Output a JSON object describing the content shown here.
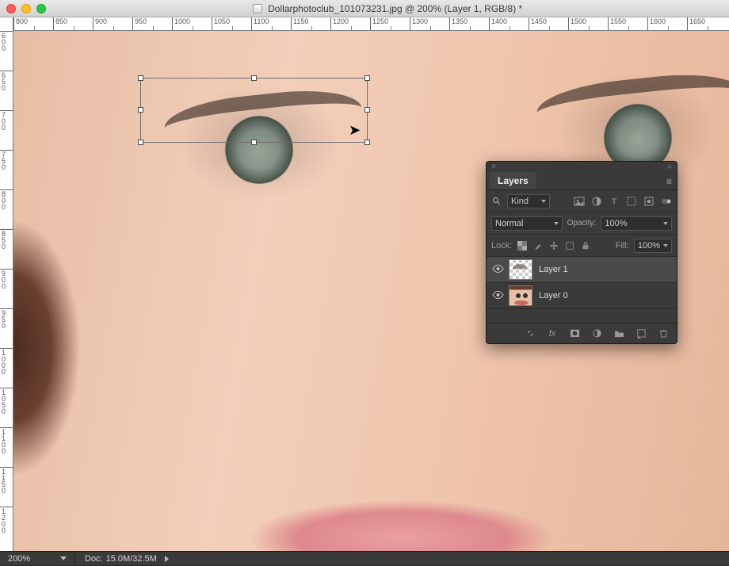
{
  "window": {
    "title": "Dollarphotoclub_101073231.jpg @ 200% (Layer 1, RGB/8) *"
  },
  "rulers": {
    "horizontal": [
      "800",
      "850",
      "900",
      "950",
      "1000",
      "1050",
      "1100",
      "1150",
      "1200",
      "1250",
      "1300",
      "1350",
      "1400",
      "1450",
      "1500",
      "1550",
      "1600",
      "1650"
    ],
    "vertical": [
      "600",
      "650",
      "700",
      "750",
      "800",
      "850",
      "900",
      "950",
      "1000",
      "1050",
      "1100",
      "1150",
      "1200"
    ]
  },
  "status": {
    "zoom": "200%",
    "doc_label": "Doc:",
    "doc_value": "15.0M/32.5M"
  },
  "panel": {
    "title": "Layers",
    "filter_kind": "Kind",
    "blend_mode": "Normal",
    "opacity_label": "Opacity:",
    "opacity_value": "100%",
    "lock_label": "Lock:",
    "fill_label": "Fill:",
    "fill_value": "100%",
    "layers": [
      {
        "name": "Layer 1",
        "selected": true
      },
      {
        "name": "Layer 0",
        "selected": false
      }
    ]
  }
}
